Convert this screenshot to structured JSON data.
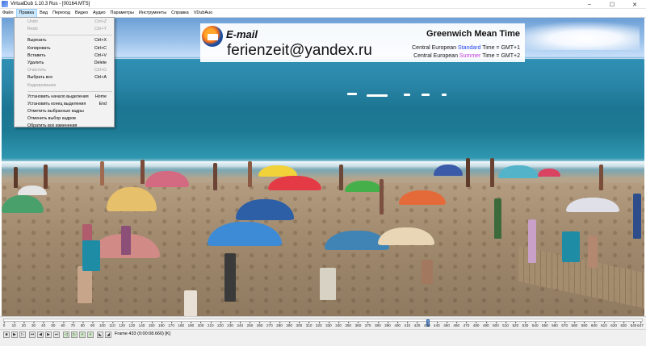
{
  "window": {
    "title": "VirtualDub 1.10.3 Rus - [00164.MTS]",
    "controls": [
      "–",
      "☐",
      "✕"
    ]
  },
  "menubar": {
    "items": [
      "Файл",
      "Правка",
      "Вид",
      "Переход",
      "Видео",
      "Аудио",
      "Параметры",
      "Инструменты",
      "Справка",
      "VDubAuo"
    ],
    "active": "Правка"
  },
  "edit_menu": {
    "items": [
      {
        "label": "Undo",
        "shortcut": "Ctrl+Z",
        "enabled": false
      },
      {
        "label": "Redo",
        "shortcut": "Ctrl+Y",
        "enabled": false
      },
      {
        "separator": true
      },
      {
        "label": "Вырезать",
        "shortcut": "Ctrl+X",
        "enabled": true
      },
      {
        "label": "Копировать",
        "shortcut": "Ctrl+C",
        "enabled": true
      },
      {
        "label": "Вставить",
        "shortcut": "Ctrl+V",
        "enabled": true
      },
      {
        "label": "Удалить",
        "shortcut": "Delete",
        "enabled": true
      },
      {
        "label": "Очистить",
        "shortcut": "Ctrl+D",
        "enabled": false
      },
      {
        "label": "Выбрать все",
        "shortcut": "Ctrl+A",
        "enabled": true
      },
      {
        "label": "Кадрирование",
        "shortcut": "",
        "enabled": false
      },
      {
        "separator": true
      },
      {
        "label": "Установить начало выделения",
        "shortcut": "Home",
        "enabled": true
      },
      {
        "label": "Установить конец выделения",
        "shortcut": "End",
        "enabled": true
      },
      {
        "label": "Отметить выбранные кадры",
        "shortcut": "",
        "enabled": true
      },
      {
        "label": "Отменить выбор кадров",
        "shortcut": "",
        "enabled": true
      },
      {
        "label": "Обратить все изменения",
        "shortcut": "",
        "enabled": true
      }
    ]
  },
  "overlay": {
    "email_label": "E-mail",
    "email_value": "ferienzeit@yandex.ru",
    "gmt_title": "Greenwich Mean Time",
    "line1_prefix": "Central European ",
    "line1_highlight": "Standard",
    "line1_suffix": " Time = GMT+1",
    "line2_prefix": "Central European ",
    "line2_highlight": "Summer",
    "line2_suffix": " Time = GMT+2",
    "colors": {
      "standard": "#2244ee",
      "summer": "#c039d6"
    }
  },
  "timeline": {
    "ticks": [
      "0",
      "10",
      "20",
      "30",
      "40",
      "50",
      "60",
      "70",
      "80",
      "90",
      "100",
      "110",
      "120",
      "130",
      "140",
      "150",
      "160",
      "170",
      "180",
      "190",
      "200",
      "210",
      "220",
      "230",
      "240",
      "250",
      "260",
      "270",
      "280",
      "290",
      "300",
      "310",
      "320",
      "330",
      "340",
      "350",
      "360",
      "370",
      "380",
      "390",
      "400",
      "410",
      "420",
      "430",
      "440",
      "450",
      "460",
      "470",
      "480",
      "490",
      "500",
      "510",
      "520",
      "530",
      "540",
      "550",
      "560",
      "570",
      "580",
      "590",
      "600",
      "610",
      "620",
      "630",
      "640",
      "647"
    ],
    "current_frame": 433,
    "total_frames": 647
  },
  "toolbar": {
    "frame_label": "Frame 433 (0:00:08.660) [K]"
  }
}
